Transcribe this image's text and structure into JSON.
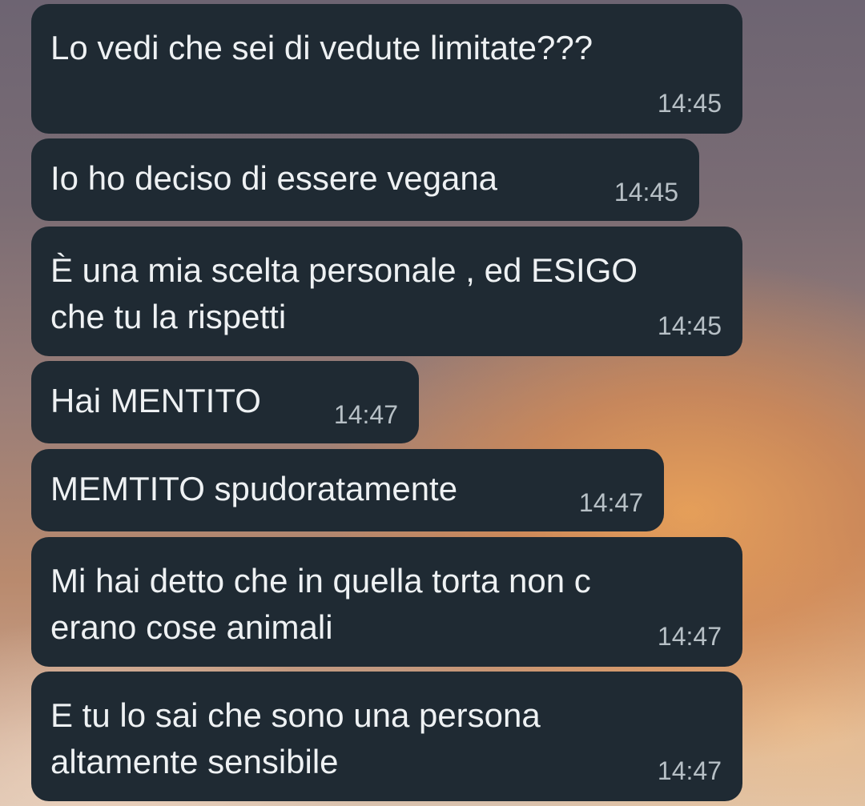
{
  "messages": [
    {
      "text": "Lo vedi che sei di vedute limitate???",
      "time": "14:45"
    },
    {
      "text": "Io ho deciso di essere vegana",
      "time": "14:45"
    },
    {
      "text": "È una mia scelta personale , ed ESIGO\nche tu la rispetti",
      "time": "14:45"
    },
    {
      "text": "Hai MENTITO",
      "time": "14:47"
    },
    {
      "text": "MEMTITO spudoratamente",
      "time": "14:47"
    },
    {
      "text": "Mi hai detto che in quella torta non c\nerano cose animali",
      "time": "14:47"
    },
    {
      "text": "E tu lo sai che sono una persona\naltamente sensibile",
      "time": "14:47"
    }
  ],
  "colors": {
    "bubble": "#1f2a33",
    "text": "#eef1f3",
    "time": "#b7c0c6"
  }
}
